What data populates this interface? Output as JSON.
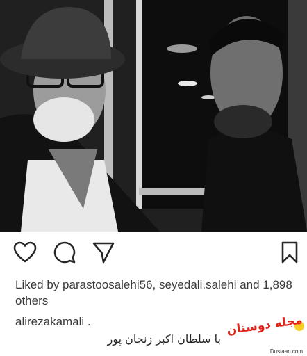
{
  "post": {
    "photo_alt": "",
    "likes_line": "Liked by parastoosalehi56, seyedali.salehi and 1,898 others",
    "caption_username": "alirezakamali .",
    "caption_text": "با سلطان اکبر زنجان پور"
  },
  "actions": {
    "like_icon": "heart-icon",
    "comment_icon": "comment-icon",
    "share_icon": "send-icon",
    "save_icon": "bookmark-icon"
  },
  "watermark": {
    "logo_text": "مجله دوستان",
    "site_text": "Dustaan.com"
  },
  "colors": {
    "text": "#262626",
    "watermark_red": "#e2231a",
    "watermark_yellow": "#f7c400"
  }
}
